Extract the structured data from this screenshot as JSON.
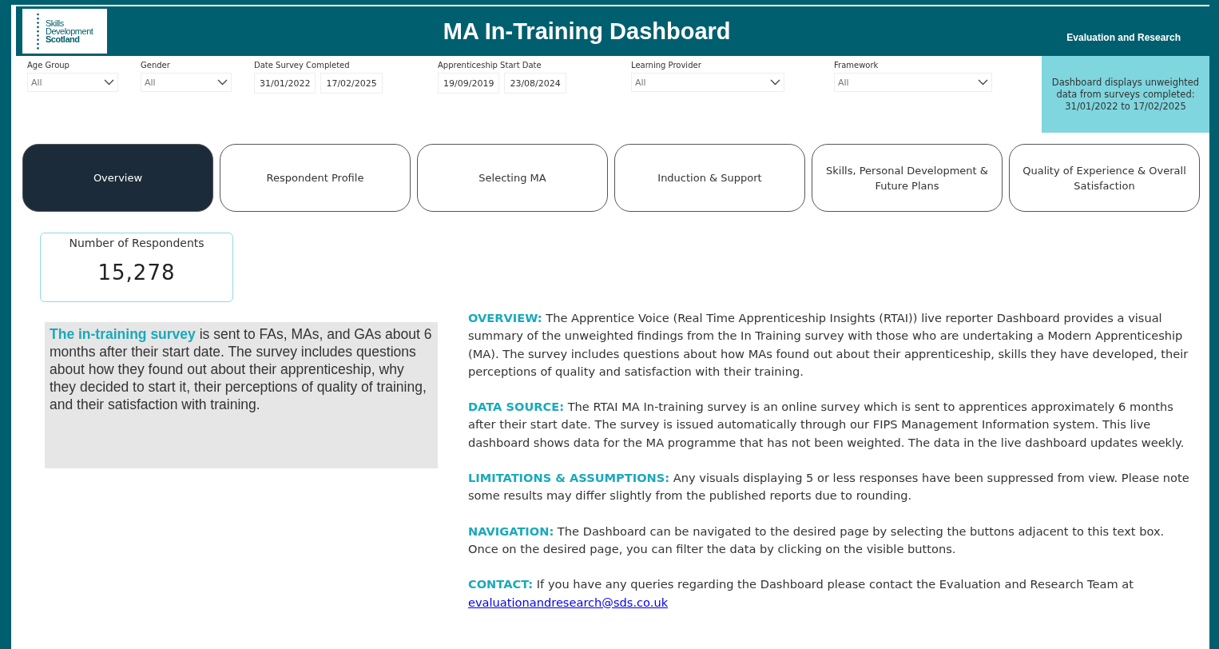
{
  "header": {
    "logo": [
      "Skills",
      "Development",
      "Scotland"
    ],
    "title": "MA In-Training Dashboard",
    "subtitle": "Evaluation and Research"
  },
  "filters": [
    {
      "kind": "dropdown",
      "label": "Age Group",
      "value": "All"
    },
    {
      "kind": "dropdown",
      "label": "Gender",
      "value": "All"
    },
    {
      "kind": "daterange",
      "label": "Date Survey Completed",
      "from": "31/01/2022",
      "to": "17/02/2025"
    },
    {
      "kind": "daterange",
      "label": "Apprenticeship Start Date",
      "from": "19/09/2019",
      "to": "23/08/2024"
    },
    {
      "kind": "dropdown",
      "label": "Learning Provider",
      "value": "All"
    },
    {
      "kind": "dropdown",
      "label": "Framework",
      "value": "All"
    }
  ],
  "info_note": "Dashboard displays unweighted data from surveys completed: 31/01/2022 to 17/02/2025",
  "tabs": [
    {
      "label": "Overview",
      "selected": true
    },
    {
      "label": "Respondent Profile",
      "selected": false
    },
    {
      "label": "Selecting MA",
      "selected": false
    },
    {
      "label": "Induction & Support",
      "selected": false
    },
    {
      "label": "Skills, Personal Development & Future Plans",
      "selected": false
    },
    {
      "label": "Quality of Experience & Overall Satisfaction",
      "selected": false
    }
  ],
  "kpi": {
    "label": "Number of Respondents",
    "value": "15,278"
  },
  "intro": "**The in-training survey** is sent to FAs, MAs, and GAs about 6 months after their start date. The survey includes questions about how they found out about their apprenticeship, why they decided to start it, their perceptions of quality of training, and their satisfaction with training.",
  "sections": [
    {
      "text": "**OVERVIEW:** The Apprentice Voice (Real Time Apprenticeship Insights (RTAI)) live reporter Dashboard provides a visual summary of the unweighted findings from the In Training survey with those who are undertaking a Modern Apprenticeship (MA). The survey includes questions about how MAs found out about their apprenticeship, skills they have developed, their perceptions of quality and satisfaction with their training."
    },
    {
      "text": "**DATA SOURCE:** The RTAI MA In-training survey is an online survey which is sent to apprentices approximately 6 months after their start date. The survey is issued automatically through our FIPS Management Information system. This live dashboard shows data for the MA programme that has not been weighted. The data in the live dashboard updates weekly."
    },
    {
      "text": "**LIMITATIONS & ASSUMPTIONS:** Any visuals displaying 5 or less responses have been suppressed from view. Please note some results may differ slightly from the published reports due to rounding."
    },
    {
      "text": "**NAVIGATION:** The Dashboard can be navigated to the desired page by selecting the buttons adjacent to this text box. Once on the desired page, you can filter the data by clicking on the visible buttons."
    },
    {
      "text": "**CONTACT:** If you have any queries regarding the Dashboard please contact the Evaluation and Research Team at",
      "link": "evaluationandresearch@sds.co.uk"
    }
  ]
}
